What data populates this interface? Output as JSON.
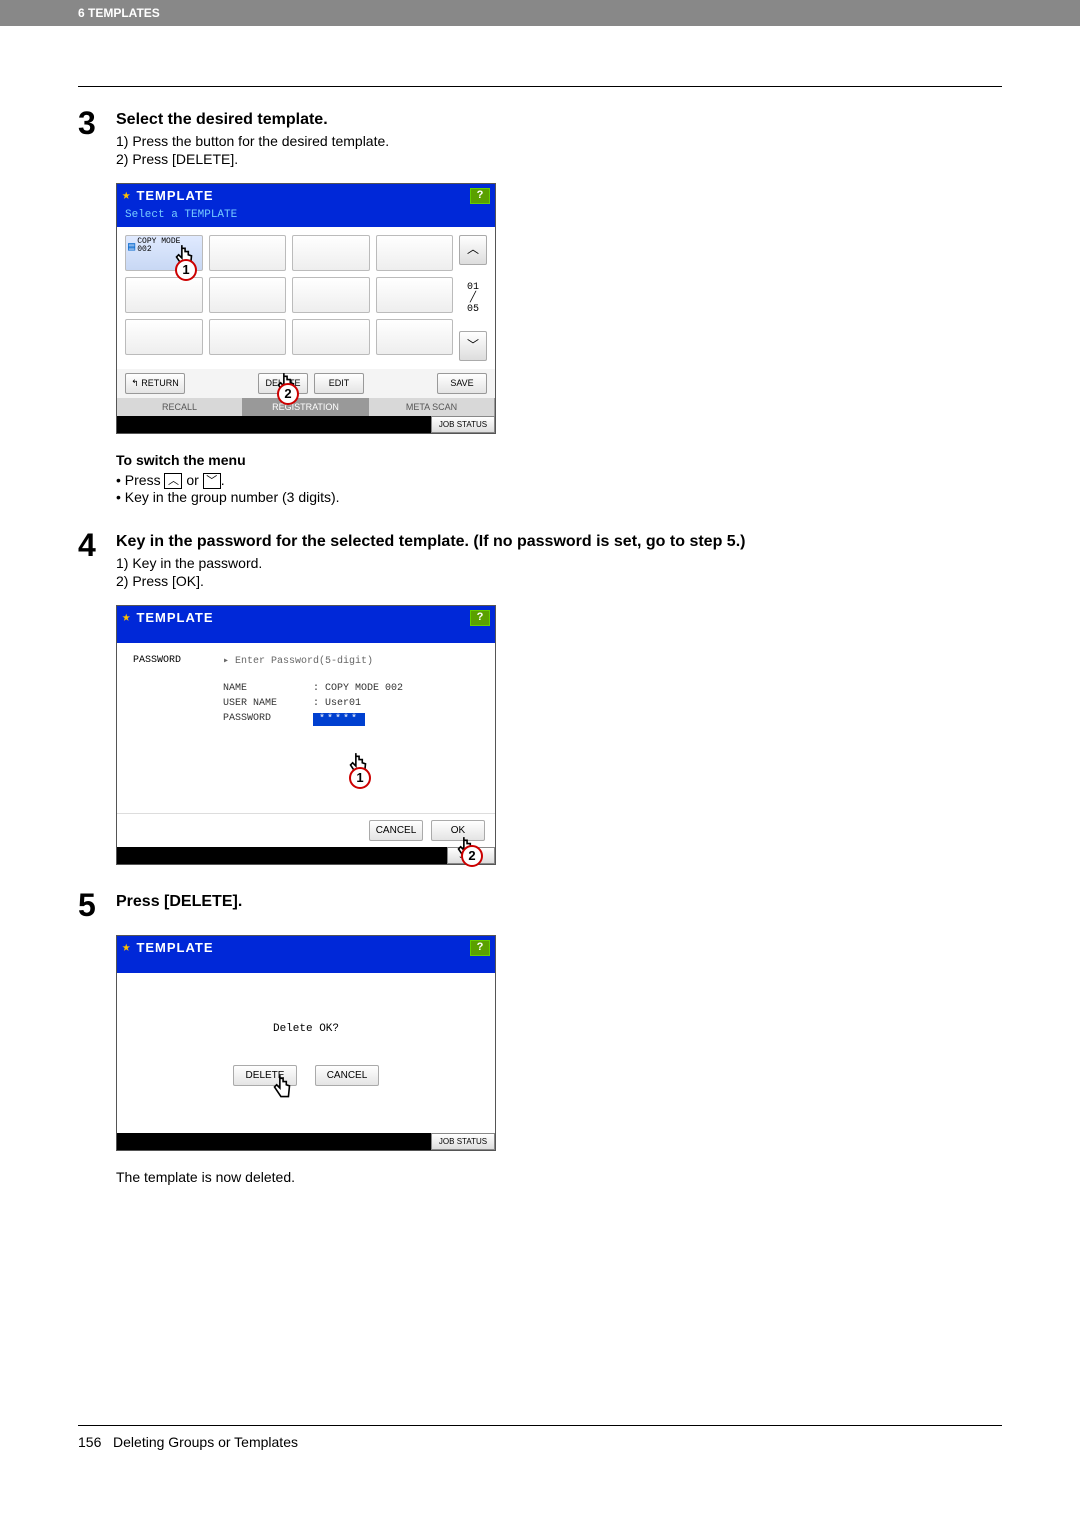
{
  "header_bar": "6 TEMPLATES",
  "step3": {
    "num": "3",
    "title": "Select the desired template.",
    "li1": "1)  Press the button for the desired template.",
    "li2": "2)  Press [DELETE]."
  },
  "shot1": {
    "title": "TEMPLATE",
    "subtitle": "Select a TEMPLATE",
    "tile_label_l1": "COPY MODE",
    "tile_label_l2": "002",
    "page_top": "01",
    "page_bot": "05",
    "up": "〈",
    "down": "〉",
    "return": "↰  RETURN",
    "delete": "DELETE",
    "edit": "EDIT",
    "save": "SAVE",
    "recall": "RECALL",
    "regist": "REGISTRATION",
    "meta": "META SCAN",
    "jobstatus": "JOB STATUS",
    "c1": "1",
    "c2": "2"
  },
  "switch": {
    "heading": "To switch the menu",
    "b1a": "Press ",
    "b1b": " or ",
    "b1c": ".",
    "up": "︿",
    "down": "﹀",
    "b2": "Key in the group number (3 digits)."
  },
  "step4": {
    "num": "4",
    "title": "Key in the password for the selected template. (If no password is set, go to step 5.)",
    "li1": "1)  Key in the password.",
    "li2": "2)  Press [OK]."
  },
  "shot2": {
    "title": "TEMPLATE",
    "pw_label": "PASSWORD",
    "hint": "▸ Enter Password(5-digit)",
    "name_l": "NAME",
    "name_v": ": COPY MODE 002",
    "user_l": "USER NAME",
    "user_v": ": User01",
    "pass_l": "PASSWORD",
    "pass_v": "*****",
    "cancel": "CANCEL",
    "ok": "OK",
    "jobstatus": "JOB S",
    "c1": "1",
    "c2": "2"
  },
  "step5": {
    "num": "5",
    "title": "Press [DELETE]."
  },
  "shot3": {
    "title": "TEMPLATE",
    "question": "Delete OK?",
    "delete": "DELETE",
    "cancel": "CANCEL",
    "jobstatus": "JOB STATUS"
  },
  "result": "The template is now deleted.",
  "footer": {
    "page": "156",
    "title": "Deleting Groups or Templates"
  }
}
